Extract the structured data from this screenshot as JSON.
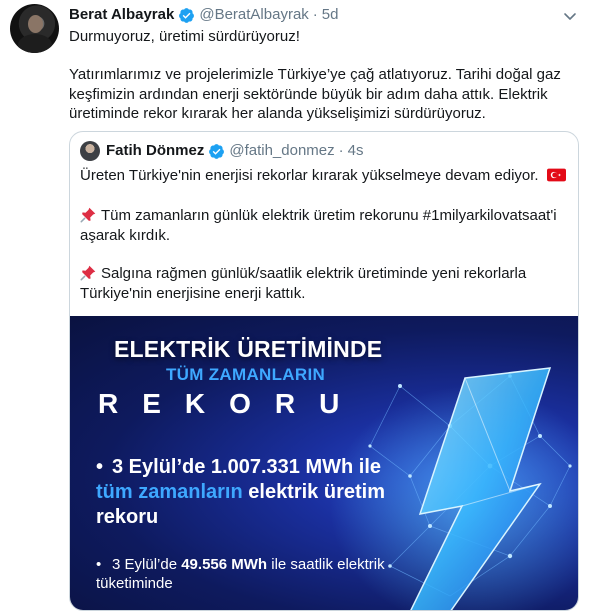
{
  "tweet": {
    "author_name": "Berat Albayrak",
    "author_handle": "@BeratAlbayrak",
    "separator": "·",
    "time": "5d",
    "line1": "Durmuyoruz, üretimi sürdürüyoruz!",
    "para2": "Yatırımlarımız ve projelerimizle Türkiye’ye çağ atlatıyoruz. Tarihi doğal gaz keşfimizin ardından enerji sektöründe büyük bir adım daha attık. Elektrik üretiminde rekor kırarak her alanda yükselişimizi sürdürüyoruz."
  },
  "quote": {
    "author_name": "Fatih Dönmez",
    "author_handle": "@fatih_donmez",
    "separator": "·",
    "time": "4s",
    "line1": "Üreten Türkiye'nin enerjisi rekorlar kırarak yükselmeye devam ediyor.",
    "line2": "Tüm zamanların günlük elektrik üretim rekorunu #1milyarkilovatsaat'i aşarak kırdık.",
    "line3": "Salgına rağmen günlük/saatlik elektrik üretiminde yeni rekorlarla Türkiye'nin enerjisine enerji kattık.",
    "flag_icon": "turkey-flag",
    "pin_icon": "pushpin"
  },
  "media": {
    "title": "ELEKTRİK ÜRETİMİNDE",
    "subtitle": "TÜM ZAMANLARIN",
    "headline": "REKORU",
    "bullet1_prefix": "3 Eylül’de 1.007.331 MWh ile ",
    "bullet1_highlight": "tüm zamanların",
    "bullet1_suffix": " elektrik üretim rekoru",
    "bullet2_prefix": "3 Eylül’de ",
    "bullet2_bold": "49.556 MWh",
    "bullet2_suffix": " ile saatlik elektrik tüketiminde",
    "bullet_symbol": "•"
  },
  "colors": {
    "verified": "#1da1f2",
    "secondary_text": "#657786",
    "highlight_blue": "#3ea8ff",
    "media_bg": "#142a8c"
  }
}
